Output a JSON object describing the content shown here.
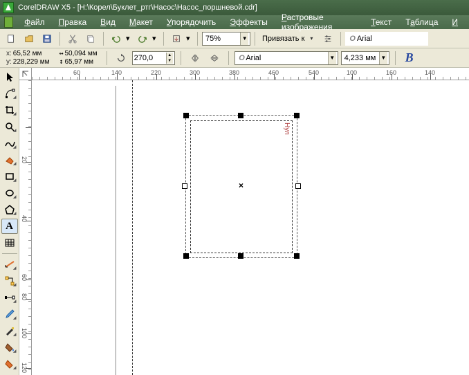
{
  "titlebar": {
    "title": "CorelDRAW X5 - [H:\\Корел\\Буклет_ртг\\Насос\\Насос_поршневой.cdr]"
  },
  "menu": {
    "file": "Файл",
    "edit": "Правка",
    "view": "Вид",
    "layout": "Макет",
    "arrange": "Упорядочить",
    "effects": "Эффекты",
    "bitmaps": "Растровые изображения",
    "text": "Текст",
    "table": "Таблица",
    "tools": "И"
  },
  "std_toolbar": {
    "zoom": "75%",
    "snap_label": "Привязать к",
    "font": "Arial"
  },
  "propbar": {
    "x_label": "x:",
    "x_val": "65,52 мм",
    "y_label": "y:",
    "y_val": "228,229 мм",
    "w_val": "50,094 мм",
    "h_val": "65,97 мм",
    "angle": "270,0",
    "font": "Arial",
    "fontsize": "4,233 мм"
  },
  "hruler": [
    "60",
    "140",
    "220",
    "300",
    "380",
    "460",
    "540",
    "100",
    "160",
    "140"
  ],
  "vruler": [
    "20",
    "40",
    "60",
    "80",
    "100",
    "120"
  ],
  "hruler_labels": [
    {
      "pos": 60,
      "txt": "60"
    },
    {
      "pos": 115,
      "txt": "140"
    },
    {
      "pos": 172,
      "txt": "220"
    },
    {
      "pos": 228,
      "txt": "300"
    },
    {
      "pos": 285,
      "txt": "380"
    },
    {
      "pos": 342,
      "txt": "460"
    },
    {
      "pos": 400,
      "txt": "540"
    },
    {
      "pos": 455,
      "txt": "100"
    },
    {
      "pos": 512,
      "txt": "160"
    },
    {
      "pos": 568,
      "txt": "140"
    }
  ],
  "vruler_labels": [
    {
      "pos": 60,
      "txt": ""
    },
    {
      "pos": 110,
      "txt": "20"
    },
    {
      "pos": 195,
      "txt": "40"
    },
    {
      "pos": 280,
      "txt": "60"
    },
    {
      "pos": 308,
      "txt": "80"
    },
    {
      "pos": 358,
      "txt": "100"
    },
    {
      "pos": 408,
      "txt": "120"
    }
  ],
  "text_object": "Нул"
}
